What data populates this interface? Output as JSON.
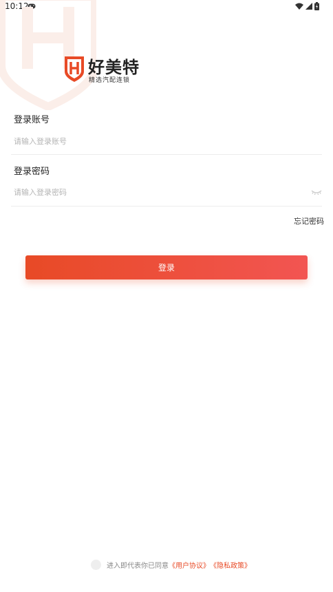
{
  "status_bar": {
    "time": "10:12",
    "icons": [
      "gamepad-icon",
      "wifi-icon",
      "signal-icon",
      "battery-icon"
    ]
  },
  "brand": {
    "name": "好美特",
    "slogan": "精选汽配连锁",
    "logo_letter": "H",
    "accent": "#e84a26"
  },
  "form": {
    "account": {
      "label": "登录账号",
      "placeholder": "请输入登录账号",
      "value": ""
    },
    "password": {
      "label": "登录密码",
      "placeholder": "请输入登录密码",
      "value": "",
      "toggle_icon": "eye-closed-icon"
    },
    "forgot_label": "忘记密码",
    "login_label": "登录"
  },
  "agreement": {
    "checked": false,
    "text": "进入即代表你已同意",
    "user_agreement": "《用户协议》",
    "privacy_policy": "《隐私政策》"
  },
  "colors": {
    "button_start": "#e84a26",
    "button_end": "#f25552",
    "placeholder": "#b5b5b5",
    "divider": "#ececec"
  }
}
